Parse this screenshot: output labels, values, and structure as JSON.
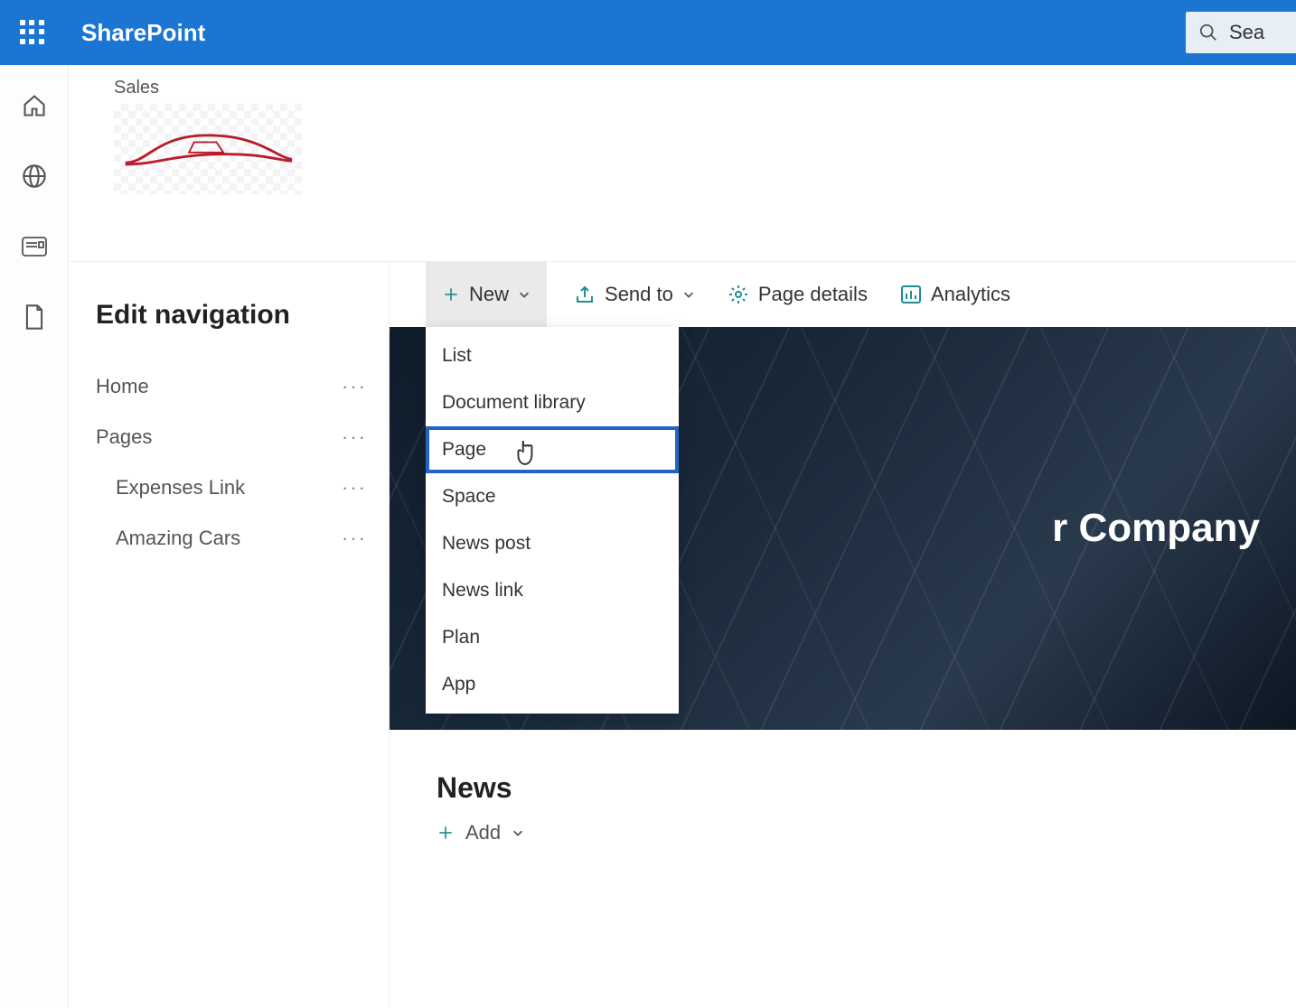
{
  "suite": {
    "brand": "SharePoint",
    "search_placeholder": "Sea"
  },
  "site": {
    "label": "Sales"
  },
  "nav": {
    "title": "Edit navigation",
    "items": [
      {
        "label": "Home",
        "child": false
      },
      {
        "label": "Pages",
        "child": false
      },
      {
        "label": "Expenses Link",
        "child": true
      },
      {
        "label": "Amazing Cars",
        "child": true
      }
    ]
  },
  "toolbar": {
    "new_label": "New",
    "send_to_label": "Send to",
    "page_details_label": "Page details",
    "analytics_label": "Analytics"
  },
  "new_menu": {
    "items": [
      "List",
      "Document library",
      "Page",
      "Space",
      "News post",
      "News link",
      "Plan",
      "App"
    ],
    "selected_index": 2
  },
  "hero": {
    "title_fragment": "r Company"
  },
  "news": {
    "heading": "News",
    "add_label": "Add"
  }
}
